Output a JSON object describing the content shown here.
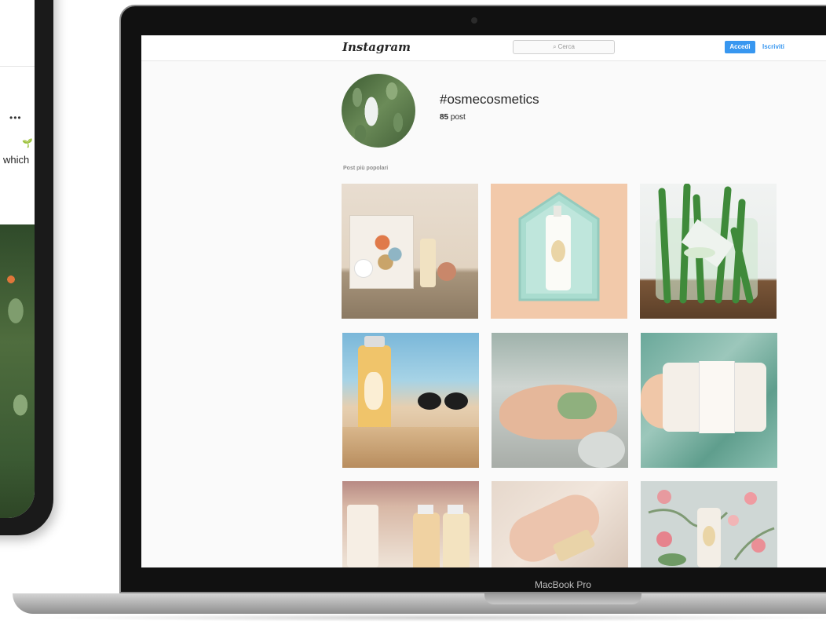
{
  "phone": {
    "more_label": "•••",
    "sprout_icon": "sprout-icon",
    "caption_fragment": "which"
  },
  "laptop": {
    "bezel_label": "MacBook Pro"
  },
  "instagram": {
    "logo": "Instagram",
    "search": {
      "placeholder": "Cerca",
      "icon": "search-icon"
    },
    "login_label": "Accedi",
    "signup_label": "Iscriviti",
    "hashtag": "#osmecosmetics",
    "post_count": "85",
    "post_count_label": "post",
    "section_title": "Post più popolari",
    "accent_color": "#3897f0",
    "posts": [
      {
        "subject": "gift-box-with-bottles"
      },
      {
        "subject": "bottle-in-house-shelf"
      },
      {
        "subject": "green-leaves-in-vase"
      },
      {
        "subject": "bottle-and-sunglasses-on-beach"
      },
      {
        "subject": "hands-holding-soap"
      },
      {
        "subject": "hand-holding-soap-bar"
      },
      {
        "subject": "shampoo-bottles-set"
      },
      {
        "subject": "hands-with-soap-bar"
      },
      {
        "subject": "bottle-on-floral-wallpaper"
      }
    ]
  }
}
